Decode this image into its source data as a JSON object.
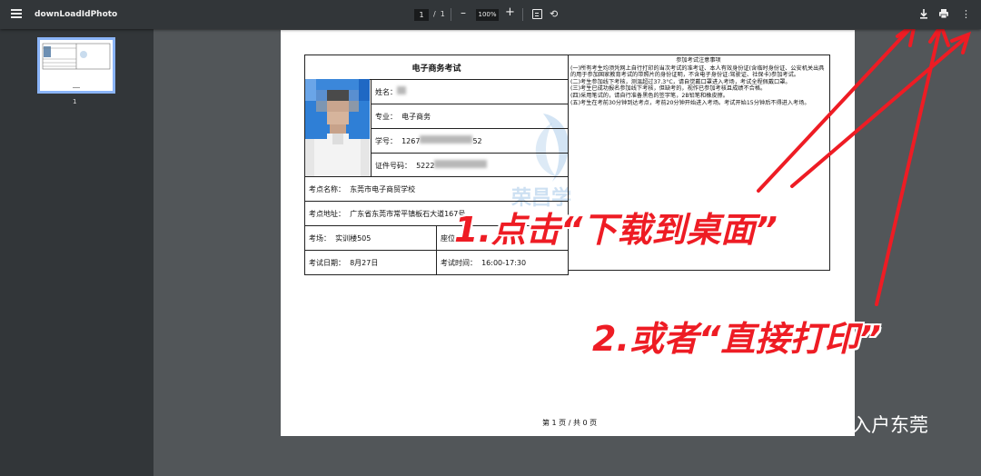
{
  "toolbar": {
    "title": "downLoadIdPhoto",
    "page_current": "1",
    "page_sep": "/",
    "page_total": "1",
    "zoom": "100%",
    "zoom_minus": "–",
    "zoom_plus": "+",
    "more": "⋮"
  },
  "sidebar": {
    "thumb_label": "1"
  },
  "doc": {
    "exam_title": "电子商务考试",
    "name_label": "姓名：",
    "major_label": "专业：",
    "major_value": "电子商务",
    "student_id_label": "学号：",
    "student_id_start": "1267",
    "student_id_end": "52",
    "id_label": "证件号码：",
    "id_start": "5222",
    "venue_label": "考点名称：",
    "venue_value": "东莞市电子商贸学校",
    "address_label": "考点地址：",
    "address_value": "广东省东莞市常平镇板石大道167号",
    "room_label": "考场：",
    "room_value": "实训楼505",
    "seat_label": "座位",
    "date_label": "考试日期：",
    "date_value": "8月27日",
    "time_label": "考试时间：",
    "time_value": "16:00-17:30",
    "notice_title": "参加考试注意事项",
    "notice_lines": [
      "(一)所有考生均须凭网上自行打印的当次考试的准考证、本人有效身份证(含临时身份证、公安机关出具的用于参加国家教育考试的带照片的身份证明，不含电子身份证:驾驶证、社保卡)参加考试。",
      "(二)考生参加线下考核，测温超过37.3°C，请自觉戴口罩进入考场，考试全程佩戴口罩。",
      "(三)考生已成功报名参加线下考核，但缺考的，视作已参加考核且成绩不合格。",
      "(四)采用笔试的，请自行准备黑色的签字笔，2B铅笔和橡皮擦。",
      "(五)考生在考前30分钟到达考点，考前20分钟开始进入考场。考试开始15分钟后不得进入考场。"
    ],
    "footer": "第 1 页 / 共 0 页",
    "watermark": "荣昌学"
  },
  "annotations": {
    "step1": "1.点击“下载到桌面”",
    "step2": "2.或者“直接打印”"
  },
  "wechat_label": "入户东莞",
  "colors": {
    "annotation_red": "#ee1c24",
    "toolbar_bg": "#323639",
    "viewer_bg": "#525659",
    "thumb_border": "#8ab4f8"
  }
}
